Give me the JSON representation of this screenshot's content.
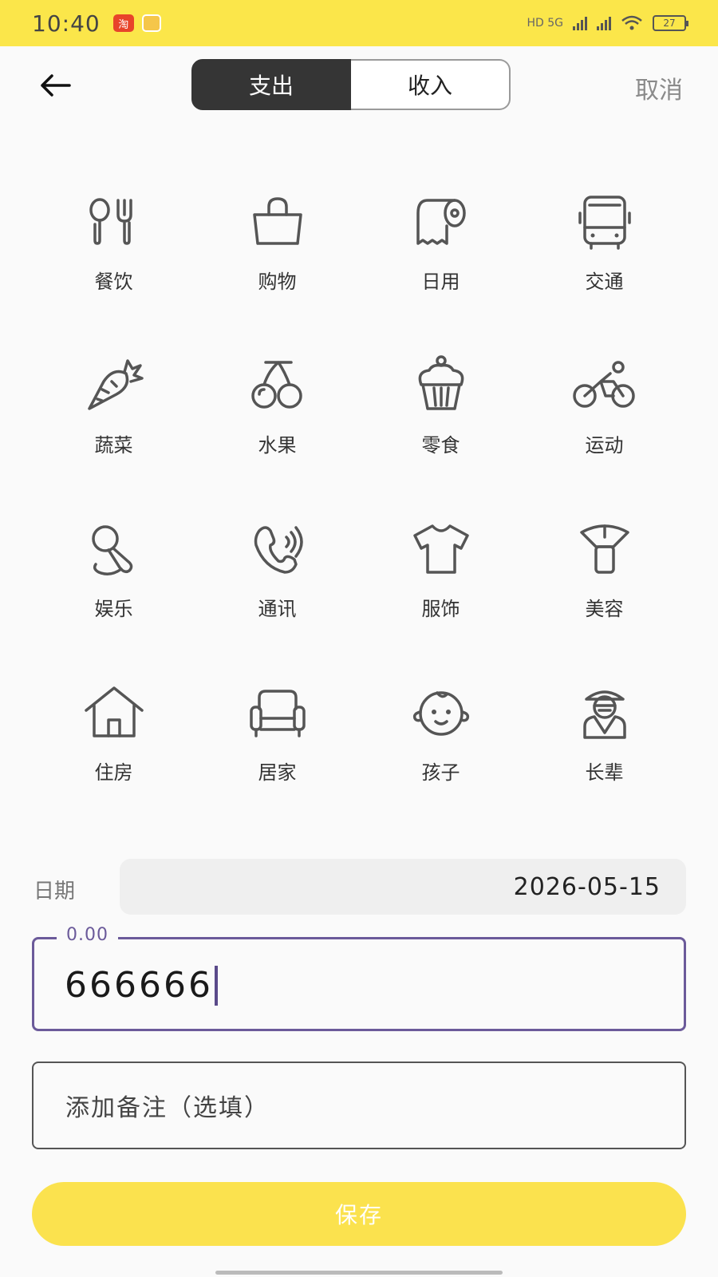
{
  "status_bar": {
    "time": "10:40",
    "app_badge": "淘",
    "network": "HD 5G",
    "battery": "27"
  },
  "header": {
    "tabs": [
      {
        "label": "支出",
        "active": true
      },
      {
        "label": "收入",
        "active": false
      }
    ],
    "cancel_label": "取消"
  },
  "categories": [
    {
      "label": "餐饮",
      "icon": "utensils-icon"
    },
    {
      "label": "购物",
      "icon": "shopping-bag-icon"
    },
    {
      "label": "日用",
      "icon": "tissue-roll-icon"
    },
    {
      "label": "交通",
      "icon": "bus-icon"
    },
    {
      "label": "蔬菜",
      "icon": "carrot-icon"
    },
    {
      "label": "水果",
      "icon": "cherry-icon"
    },
    {
      "label": "零食",
      "icon": "cupcake-icon"
    },
    {
      "label": "运动",
      "icon": "cyclist-icon"
    },
    {
      "label": "娱乐",
      "icon": "microphone-icon"
    },
    {
      "label": "通讯",
      "icon": "phone-icon"
    },
    {
      "label": "服饰",
      "icon": "tshirt-icon"
    },
    {
      "label": "美容",
      "icon": "makeup-brush-icon"
    },
    {
      "label": "住房",
      "icon": "house-icon"
    },
    {
      "label": "居家",
      "icon": "sofa-icon"
    },
    {
      "label": "孩子",
      "icon": "baby-face-icon"
    },
    {
      "label": "长辈",
      "icon": "elder-icon"
    }
  ],
  "form": {
    "date_label": "日期",
    "date_value": "2026-05-15",
    "amount_hint": "0.00",
    "amount_value": "666666",
    "note_placeholder": "添加备注（选填）",
    "save_label": "保存"
  },
  "colors": {
    "accent_yellow": "#fbe24e",
    "focus_purple": "#6b5a9a",
    "active_tab": "#353535"
  }
}
